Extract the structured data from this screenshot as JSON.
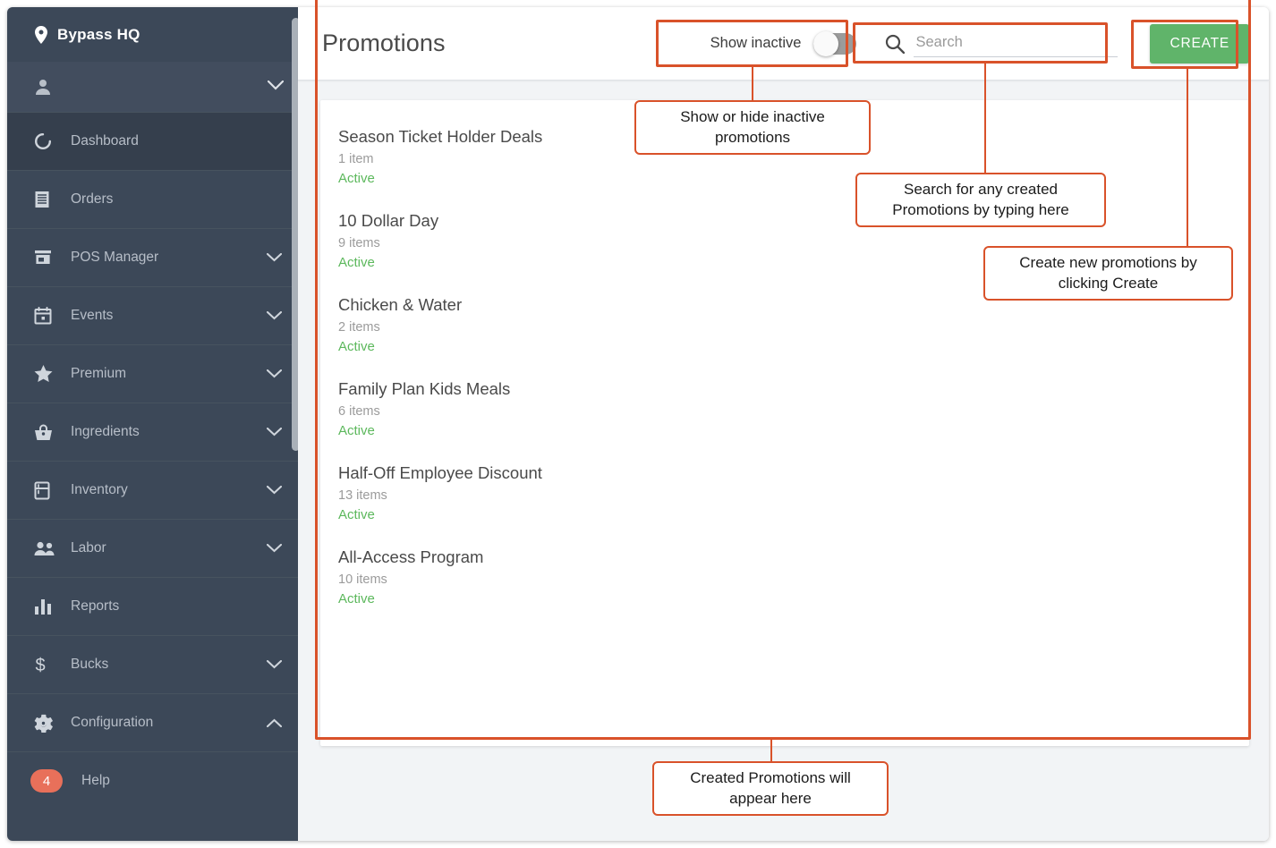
{
  "sidebar": {
    "brand": {
      "label": "Bypass HQ",
      "icon": "location-pin-icon"
    },
    "user": {
      "name": "",
      "icon": "person-icon",
      "chevron": "chevron-down-icon"
    },
    "items": [
      {
        "label": "Dashboard",
        "icon": "dashboard-icon",
        "chevron": null,
        "active": true
      },
      {
        "label": "Orders",
        "icon": "receipt-icon",
        "chevron": null,
        "active": false
      },
      {
        "label": "POS Manager",
        "icon": "store-icon",
        "chevron": "chevron-down-icon",
        "active": false
      },
      {
        "label": "Events",
        "icon": "calendar-icon",
        "chevron": "chevron-down-icon",
        "active": false
      },
      {
        "label": "Premium",
        "icon": "star-icon",
        "chevron": "chevron-down-icon",
        "active": false
      },
      {
        "label": "Ingredients",
        "icon": "basket-icon",
        "chevron": "chevron-down-icon",
        "active": false
      },
      {
        "label": "Inventory",
        "icon": "fridge-icon",
        "chevron": "chevron-down-icon",
        "active": false
      },
      {
        "label": "Labor",
        "icon": "people-icon",
        "chevron": "chevron-down-icon",
        "active": false
      },
      {
        "label": "Reports",
        "icon": "bar-chart-icon",
        "chevron": null,
        "active": false
      },
      {
        "label": "Bucks",
        "icon": "dollar-icon",
        "chevron": "chevron-down-icon",
        "active": false
      },
      {
        "label": "Configuration",
        "icon": "gear-icon",
        "chevron": "chevron-up-icon",
        "active": false
      },
      {
        "label": "Help",
        "icon": "badge-count",
        "chevron": null,
        "active": false,
        "badge": "4"
      }
    ]
  },
  "header": {
    "title": "Promotions",
    "toggle": {
      "label": "Show inactive",
      "state": "off"
    },
    "search": {
      "value": "",
      "placeholder": "Search",
      "icon": "search-icon"
    },
    "create_button": "CREATE"
  },
  "promotions": [
    {
      "name": "Season Ticket Holder Deals",
      "count": "1 item",
      "status": "Active"
    },
    {
      "name": "10 Dollar Day",
      "count": "9 items",
      "status": "Active"
    },
    {
      "name": "Chicken & Water",
      "count": "2 items",
      "status": "Active"
    },
    {
      "name": "Family Plan Kids Meals",
      "count": "6 items",
      "status": "Active"
    },
    {
      "name": "Half-Off Employee Discount",
      "count": "13 items",
      "status": "Active"
    },
    {
      "name": "All-Access Program",
      "count": "10 items",
      "status": "Active"
    }
  ],
  "annotations": [
    {
      "id": "toggle",
      "text": "Show or hide inactive promotions"
    },
    {
      "id": "search",
      "text": "Search for any created Promotions by typing here"
    },
    {
      "id": "create",
      "text": "Create new promotions by clicking Create"
    },
    {
      "id": "list",
      "text": "Created Promotions will appear here"
    }
  ],
  "colors": {
    "sidebar_bg": "#3c4858",
    "accent_green": "#60b46a",
    "status_green": "#5cb85c",
    "annotation_orange": "#d9522a",
    "badge_red": "#e8705a"
  }
}
